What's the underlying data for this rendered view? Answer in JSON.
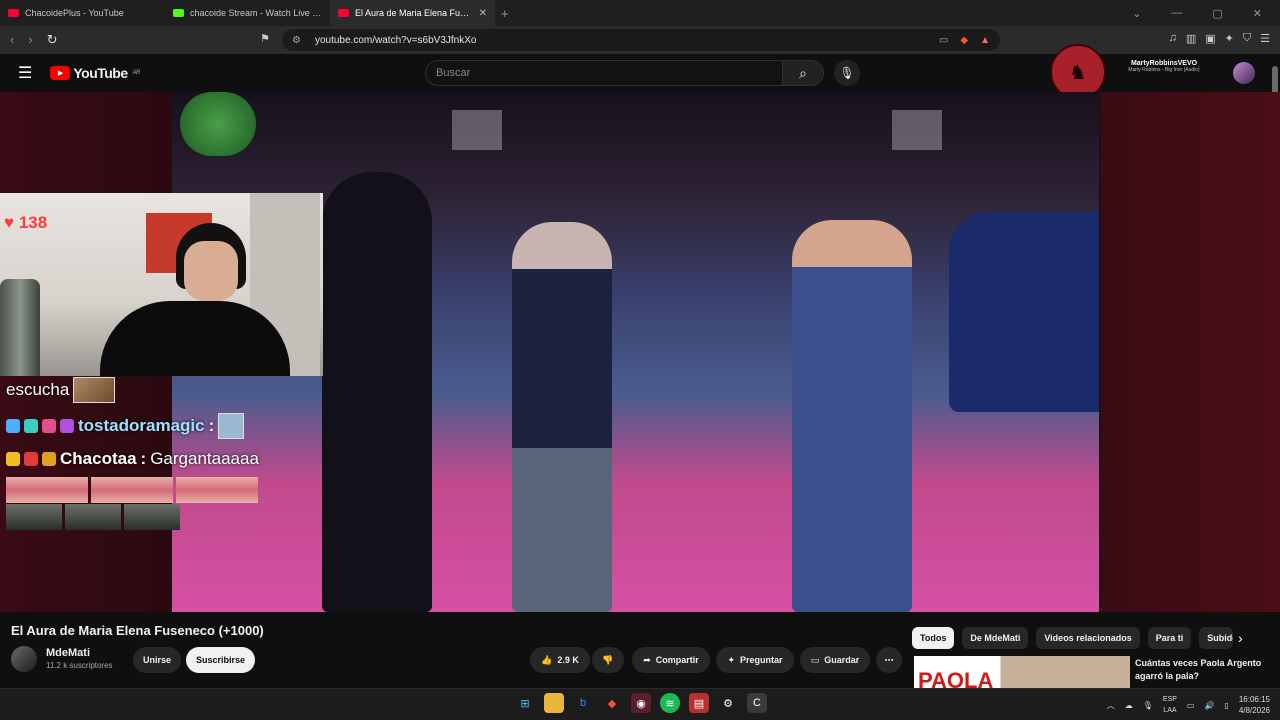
{
  "browser": {
    "tabs": [
      {
        "title": "ChacoidePlus - YouTube",
        "color": "#ff0033",
        "active": false
      },
      {
        "title": "chacoide Stream - Watch Live on",
        "color": "#53fc18",
        "active": false
      },
      {
        "title": "El Aura de Maria Elena Fusene",
        "color": "#ff0033",
        "active": true
      }
    ],
    "url": "youtube.com/watch?v=s6bV3JfnkXo"
  },
  "youtube": {
    "logo_text": "YouTube",
    "region": "AR",
    "search_placeholder": "Buscar",
    "now_playing_title": "MartyRobbinsVEVO",
    "now_playing_sub": "Marty Robbins - Big Iron (Audio)"
  },
  "stream_overlay": {
    "like_count": "138",
    "chat": [
      {
        "user": "",
        "message": "escucha"
      },
      {
        "user": "tostadoramagic",
        "message": ""
      },
      {
        "user": "Chacotaa",
        "message": "Gargantaaaaa"
      }
    ]
  },
  "video": {
    "title": "El Aura de Maria Elena Fuseneco (+1000)",
    "channel": "MdeMati",
    "subscribers": "11.2 k suscriptores",
    "join_label": "Unirse",
    "subscribe_label": "Suscribirse",
    "likes": "2.9 K",
    "share_label": "Compartir",
    "ask_label": "Preguntar",
    "save_label": "Guardar"
  },
  "chips": [
    "Todos",
    "De MdeMati",
    "Videos relacionados",
    "Para ti",
    "Subido"
  ],
  "recommended": {
    "thumb_text": "PAOLA",
    "title": "Cuántas veces Paola Argento agarró la pala?"
  },
  "taskbar": {
    "lang_top": "ESP",
    "lang_bottom": "LAA",
    "time": "16:06:15",
    "date": "4/8/2026"
  }
}
